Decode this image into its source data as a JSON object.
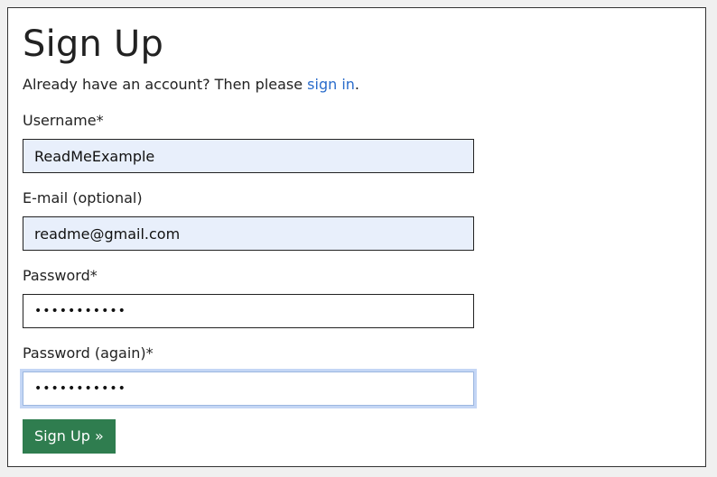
{
  "form": {
    "title": "Sign Up",
    "intro_text": "Already have an account? Then please ",
    "signin_link": "sign in",
    "intro_end": ".",
    "username_label": "Username*",
    "username_value": "ReadMeExample",
    "email_label": "E-mail (optional)",
    "email_value": "readme@gmail.com",
    "password_label": "Password*",
    "password_value": "•••••••••••",
    "password2_label": "Password (again)*",
    "password2_value": "•••••••••••",
    "submit_label": "Sign Up »"
  },
  "colors": {
    "link": "#2a6ccb",
    "button": "#2f7d4f",
    "autofill_bg": "#e8effb",
    "focus_ring": "#c4d6f5"
  }
}
